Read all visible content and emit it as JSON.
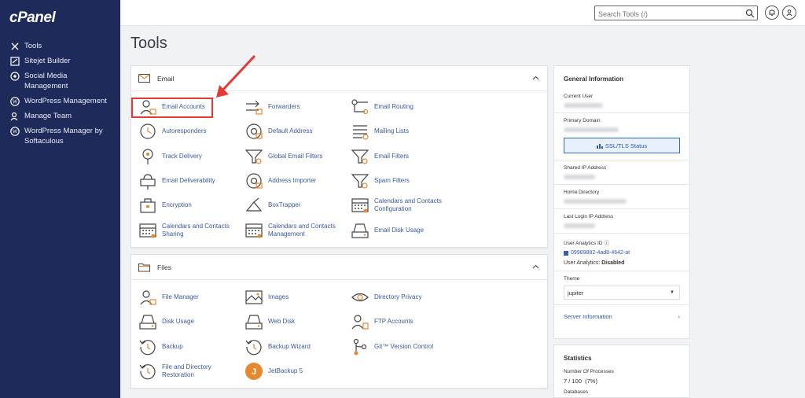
{
  "brand": "cPanel",
  "sidebar": {
    "items": [
      {
        "label": "Tools",
        "icon": "tools-icon"
      },
      {
        "label": "Sitejet Builder",
        "icon": "sitejet-icon"
      },
      {
        "label": "Social Media Management",
        "icon": "social-media-icon"
      },
      {
        "label": "WordPress Management",
        "icon": "wordpress-icon"
      },
      {
        "label": "Manage Team",
        "icon": "team-icon"
      },
      {
        "label": "WordPress Manager by Softaculous",
        "icon": "wordpress-icon"
      }
    ]
  },
  "search": {
    "placeholder": "Search Tools (/)"
  },
  "page_title": "Tools",
  "email_section": {
    "title": "Email",
    "tools": [
      [
        "Email Accounts",
        "Forwarders",
        "Email Routing"
      ],
      [
        "Autoresponders",
        "Default Address",
        "Mailing Lists"
      ],
      [
        "Track Delivery",
        "Global Email Filters",
        "Email Filters"
      ],
      [
        "Email Deliverability",
        "Address Importer",
        "Spam Filters"
      ],
      [
        "Encryption",
        "BoxTrapper",
        "Calendars and Contacts Configuration"
      ],
      [
        "Calendars and Contacts Sharing",
        "Calendars and Contacts Management",
        "Email Disk Usage"
      ]
    ]
  },
  "files_section": {
    "title": "Files",
    "tools": [
      [
        "File Manager",
        "Images",
        "Directory Privacy"
      ],
      [
        "Disk Usage",
        "Web Disk",
        "FTP Accounts"
      ],
      [
        "Backup",
        "Backup Wizard",
        "Git™ Version Control"
      ],
      [
        "File and Directory Restoration",
        "JetBackup 5"
      ]
    ]
  },
  "general_info": {
    "title": "General Information",
    "current_user_label": "Current User",
    "primary_domain_label": "Primary Domain",
    "ssl_button": "SSL/TLS Status",
    "shared_ip_label": "Shared IP Address",
    "home_dir_label": "Home Directory",
    "last_login_label": "Last Login IP Address",
    "analytics_id_label": "User Analytics ID",
    "analytics_id_value": "09989882-4ad8-4642-at",
    "analytics_status_label": "User Analytics:",
    "analytics_status_value": "Disabled",
    "theme_label": "Theme",
    "theme_value": "jupiter",
    "server_info": "Server Information"
  },
  "statistics": {
    "title": "Statistics",
    "processes_label": "Number Of Processes",
    "processes_value": "7 / 100",
    "processes_pct": "(7%)",
    "next_label": "Databases"
  },
  "colors": {
    "sidebar": "#1e2a5a",
    "accent": "#2d5aa8",
    "highlight": "#e53935",
    "icon_orange": "#e8872e"
  }
}
